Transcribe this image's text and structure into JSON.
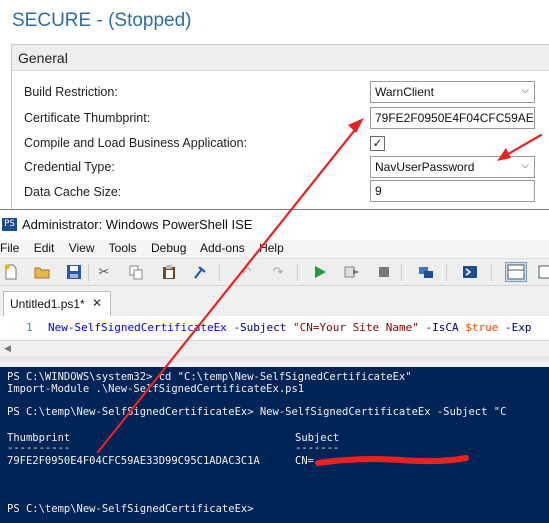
{
  "admin": {
    "title": "SECURE - (Stopped)",
    "section": "General",
    "fields": [
      {
        "label": "Build Restriction:",
        "value": "WarnClient",
        "kind": "select"
      },
      {
        "label": "Certificate Thumbprint:",
        "value": "79FE2F0950E4F04CFC59AE3...",
        "kind": "text"
      },
      {
        "label": "Compile and Load Business Application:",
        "value": "✓",
        "kind": "checkbox"
      },
      {
        "label": "Credential Type:",
        "value": "NavUserPassword",
        "kind": "select"
      },
      {
        "label": "Data Cache Size:",
        "value": "9",
        "kind": "text"
      }
    ]
  },
  "ise": {
    "title": "Administrator: Windows PowerShell ISE",
    "logo": "PS",
    "menu": [
      "File",
      "Edit",
      "View",
      "Tools",
      "Debug",
      "Add-ons",
      "Help"
    ],
    "tab": {
      "label": "Untitled1.ps1*",
      "close": "✕"
    },
    "editor": {
      "line_number": "1",
      "cmd": "New-SelfSignedCertificateEx",
      "param1": "-Subject",
      "str1": "\"CN=Your Site Name\"",
      "param2": "-IsCA",
      "var1": "$true",
      "param3": "-Exp"
    },
    "console": {
      "line1": "PS C:\\WINDOWS\\system32> cd \"C:\\temp\\New-SelfSignedCertificateEx\"",
      "line2": "Import-Module .\\New-SelfSignedCertificateEx.ps1",
      "line3": "PS C:\\temp\\New-SelfSignedCertificateEx> New-SelfSignedCertificateEx -Subject \"C",
      "col_thumb": "Thumbprint",
      "col_subject": "Subject",
      "dash_thumb": "----------",
      "dash_subject": "-------",
      "thumb_value": "79FE2F0950E4F04CFC59AE33D99C95C1ADAC3C1A",
      "subject_value": "CN=",
      "prompt": "PS C:\\temp\\New-SelfSignedCertificateEx>"
    }
  },
  "colors": {
    "title_blue": "#2e6ca4",
    "console_bg": "#012456",
    "arrow_red": "#e8231f"
  }
}
